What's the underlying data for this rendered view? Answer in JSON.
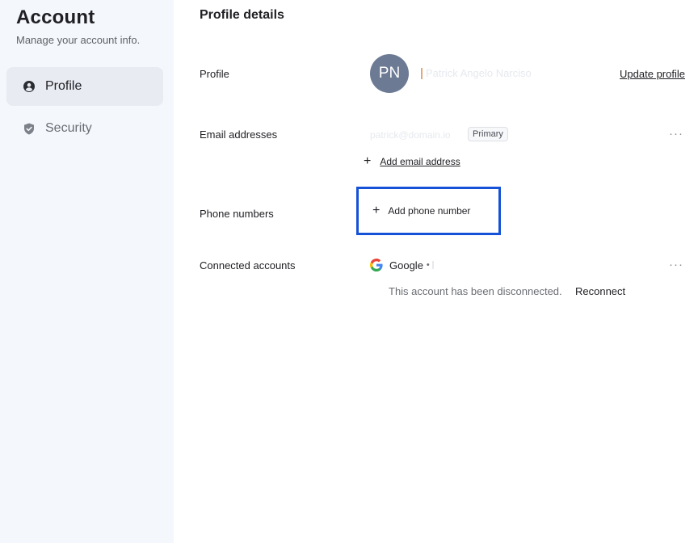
{
  "sidebar": {
    "title": "Account",
    "subtitle": "Manage your account info.",
    "items": [
      {
        "label": "Profile",
        "icon": "user-circle-icon",
        "active": true
      },
      {
        "label": "Security",
        "icon": "shield-check-icon",
        "active": false
      }
    ]
  },
  "main": {
    "title": "Profile details",
    "profile": {
      "label": "Profile",
      "initials": "PN",
      "name": "Patrick Angelo Narciso",
      "update_label": "Update profile"
    },
    "email": {
      "label": "Email addresses",
      "address": "patrick@domain.io",
      "badge": "Primary",
      "more": "···",
      "add_label": "Add email address"
    },
    "phone": {
      "label": "Phone numbers",
      "add_label": "Add phone number"
    },
    "connected": {
      "label": "Connected accounts",
      "provider": "Google",
      "separator": "•",
      "more": "···",
      "message": "This account has been disconnected.",
      "reconnect_label": "Reconnect"
    }
  },
  "colors": {
    "sidebar_bg": "#f4f7fc",
    "active_item_bg": "#e8ebf1",
    "avatar_bg": "#6c7a94",
    "focus_outline": "#1652d8"
  }
}
